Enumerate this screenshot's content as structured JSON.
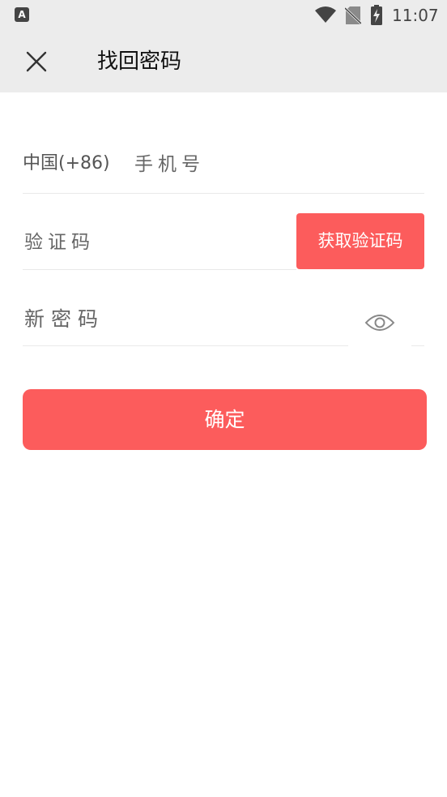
{
  "status_bar": {
    "left_icon_letter": "A",
    "time": "11:07",
    "icons": [
      "wifi-icon",
      "no-sim-icon",
      "battery-charging-icon"
    ]
  },
  "app_bar": {
    "close_icon": "close-icon",
    "title": "找回密码"
  },
  "form": {
    "country_code": "中国(+86)",
    "phone_placeholder": "手机号",
    "code_placeholder": "验证码",
    "get_code_label": "获取验证码",
    "password_placeholder": "新密码",
    "eye_icon": "eye-icon"
  },
  "confirm_label": "确定",
  "colors": {
    "accent": "#fc5c5c",
    "app_bar_bg": "#ececec",
    "divider": "#e9e9e9"
  }
}
